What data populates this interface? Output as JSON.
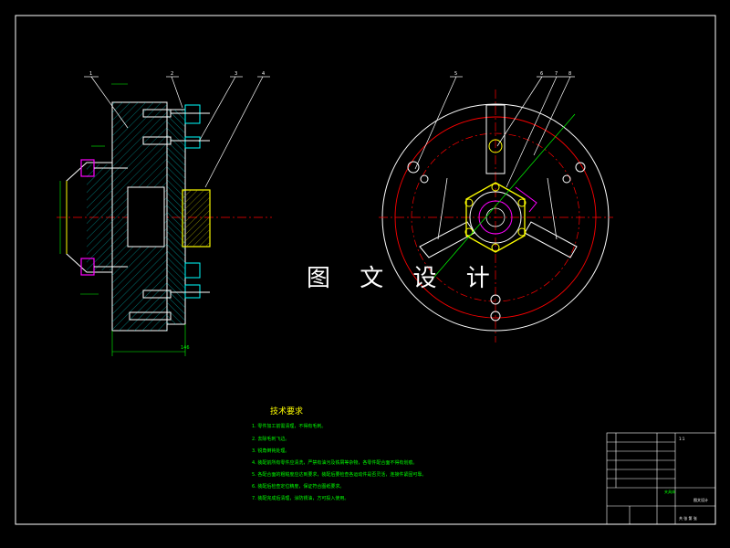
{
  "watermark": "图 文 设 计",
  "technical_requirements": {
    "title": "技术要求",
    "items": [
      "1. 零件加工前需清理，不得有毛刺。",
      "2. 去除毛刺飞边。",
      "3. 锐角倒钝处理。",
      "4. 装配前所有零件应清洗，严禁有油污及铁屑等杂物，各零件配合面不得有划痕。",
      "5. 各配合面的粗糙度应达到要求，装配后要检查各运动件是否灵活，连接件紧固可靠。",
      "6. 装配后检查定位精度，保证符合图纸要求。",
      "7. 装配完成后清理，涂防锈油，方可投入使用。"
    ]
  },
  "balloons_left": [
    "1",
    "2",
    "3",
    "4"
  ],
  "balloons_right": [
    "5",
    "6",
    "7",
    "8"
  ],
  "dimensions": {
    "width_bottom": "146"
  },
  "title_block": {
    "drawing_name": "夹具体",
    "company": "图文设计",
    "scale": "1:1",
    "sheet": "共 张 第 张"
  },
  "colors": {
    "background": "#000000",
    "border": "#ffffff",
    "part_outline": "#ffffff",
    "hatch": "#00ffff",
    "centerline": "#ff0000",
    "dimension": "#00ff00",
    "bolt": "#ffffff",
    "highlight": "#ff00ff",
    "yellow": "#ffff00"
  }
}
